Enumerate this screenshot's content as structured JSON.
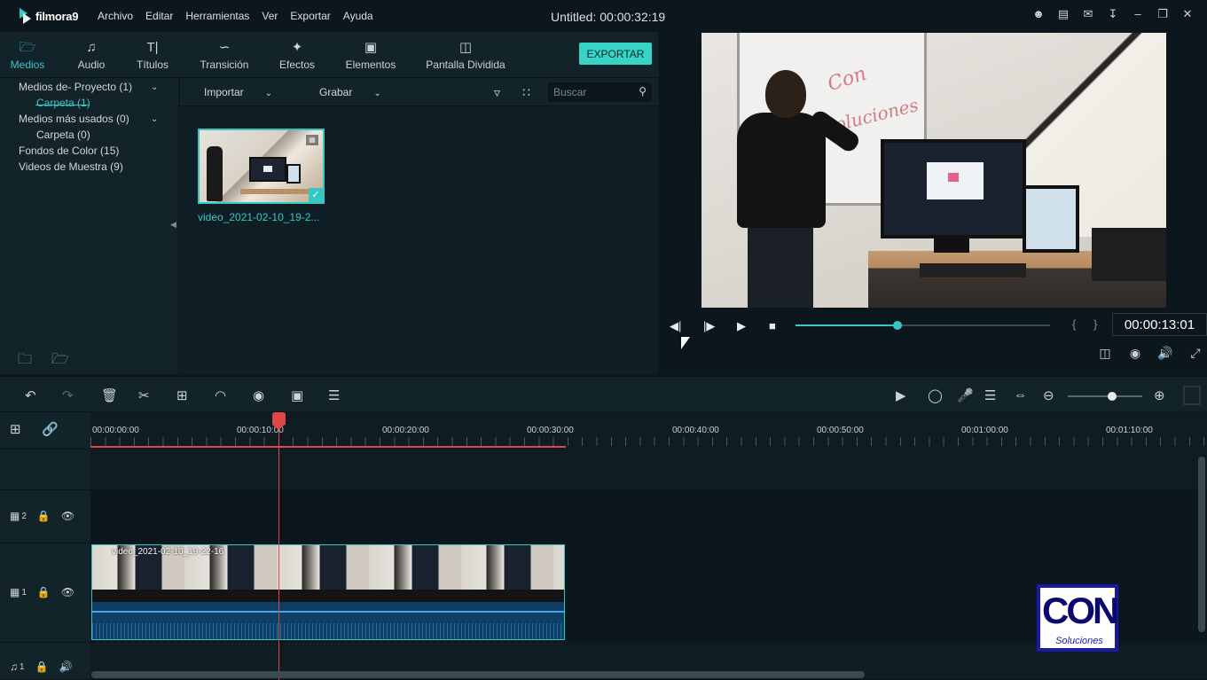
{
  "app": {
    "logo_text": "filmora9",
    "window_title": "Untitled:",
    "duration": "00:00:32:19"
  },
  "menu": [
    "Archivo",
    "Editar",
    "Herramientas",
    "Ver",
    "Exportar",
    "Ayuda"
  ],
  "title_icons": [
    "user-icon",
    "save-icon",
    "mail-icon",
    "download-icon",
    "minimize-icon",
    "restore-icon",
    "close-icon"
  ],
  "tabs": [
    {
      "label": "Medios",
      "icon": "folder-icon",
      "active": true
    },
    {
      "label": "Audio",
      "icon": "music-note-icon"
    },
    {
      "label": "Títulos",
      "icon": "text-icon"
    },
    {
      "label": "Transición",
      "icon": "transition-icon"
    },
    {
      "label": "Efectos",
      "icon": "effects-icon"
    },
    {
      "label": "Elementos",
      "icon": "image-icon"
    },
    {
      "label": "Pantalla Dividida",
      "icon": "split-screen-icon"
    }
  ],
  "export_label": "EXPORTAR",
  "sidebar": {
    "items": [
      {
        "label": "Medios de- Proyecto (1)",
        "expandable": true
      },
      {
        "label": "Carpeta (1)",
        "sub": true,
        "active": true
      },
      {
        "label": "Medios más usados (0)",
        "expandable": true
      },
      {
        "label": "Carpeta (0)",
        "sub": true
      },
      {
        "label": "Fondos de Color (15)"
      },
      {
        "label": "Videos de Muestra (9)"
      }
    ]
  },
  "media_toolbar": {
    "import_label": "Importar",
    "record_label": "Grabar",
    "search_placeholder": "Buscar"
  },
  "media_items": [
    {
      "label": "video_2021-02-10_19-2..."
    }
  ],
  "preview": {
    "whiteboard_text_1": "Con",
    "whiteboard_text_2": "Soluciones",
    "timecode": "00:00:13:01",
    "progress": 0.4
  },
  "timeline": {
    "ruler_labels": [
      "00:00:00:00",
      "00:00:10:00",
      "00:00:20:00",
      "00:00:30:00",
      "00:00:40:00",
      "00:00:50:00",
      "00:01:00:00",
      "00:01:10:00"
    ],
    "tracks": [
      {
        "label": "2",
        "type": "video"
      },
      {
        "label": "1",
        "type": "video"
      },
      {
        "label": "1",
        "type": "audio"
      }
    ],
    "clip_title": "video_2021-02-10_19-22-16",
    "zoom_level": 0.6
  },
  "watermark": {
    "big": "CON",
    "small": "Soluciones"
  },
  "colors": {
    "accent": "#37c6c4",
    "playhead": "#e0454a",
    "background": "#0f1c22"
  }
}
